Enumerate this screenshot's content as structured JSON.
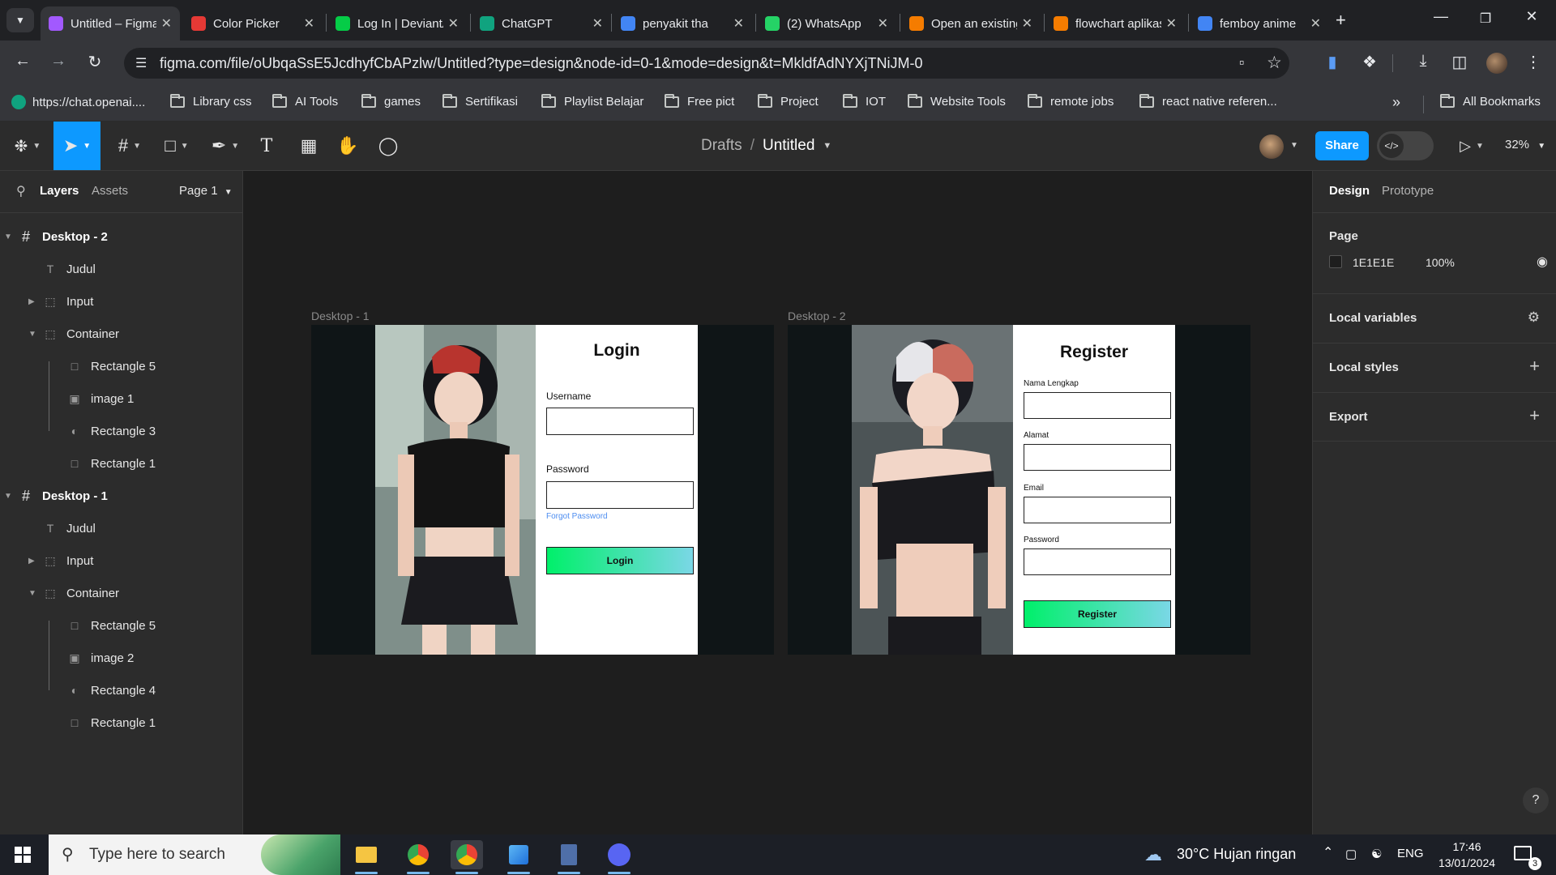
{
  "browser": {
    "tabs": [
      {
        "label": "Untitled – Figma",
        "color": "#a259ff",
        "active": true
      },
      {
        "label": "Color Picker",
        "color": "#e53935"
      },
      {
        "label": "Log In | DeviantArt",
        "color": "#05cc47"
      },
      {
        "label": "ChatGPT",
        "color": "#10a37f"
      },
      {
        "label": "penyakit tha",
        "color": "#4285f4"
      },
      {
        "label": "(2) WhatsApp",
        "color": "#25d366"
      },
      {
        "label": "Open an existing",
        "color": "#f57c00"
      },
      {
        "label": "flowchart aplikasi",
        "color": "#f57c00"
      },
      {
        "label": "femboy anime",
        "color": "#4285f4"
      }
    ],
    "url": "figma.com/file/oUbqaSsE5JcdhyfCbAPzlw/Untitled?type=design&node-id=0-1&mode=design&t=MkldfAdNYXjTNiJM-0",
    "bookmarks": [
      {
        "label": "https://chat.openai....",
        "type": "site"
      },
      {
        "label": "Library css",
        "type": "folder"
      },
      {
        "label": "AI Tools",
        "type": "folder"
      },
      {
        "label": "games",
        "type": "folder"
      },
      {
        "label": "Sertifikasi",
        "type": "folder"
      },
      {
        "label": "Playlist Belajar",
        "type": "folder"
      },
      {
        "label": "Free pict",
        "type": "folder"
      },
      {
        "label": "Project",
        "type": "folder"
      },
      {
        "label": "IOT",
        "type": "folder"
      },
      {
        "label": "Website Tools",
        "type": "folder"
      },
      {
        "label": "remote jobs",
        "type": "folder"
      },
      {
        "label": "react native referen...",
        "type": "folder"
      }
    ],
    "all_bookmarks": "All Bookmarks"
  },
  "figma": {
    "breadcrumb_parent": "Drafts",
    "breadcrumb_sep": "/",
    "file_name": "Untitled",
    "share_label": "Share",
    "zoom": "32%",
    "accent": "#0d99ff",
    "left": {
      "tab_layers": "Layers",
      "tab_assets": "Assets",
      "page_selector": "Page 1",
      "layers": [
        {
          "label": "Desktop - 2",
          "icon": "frame-icon",
          "level": 0,
          "bold": true,
          "arrow": "down"
        },
        {
          "label": "Judul",
          "icon": "text-icon",
          "level": 1
        },
        {
          "label": "Input",
          "icon": "group-icon",
          "level": 1,
          "arrow": "right"
        },
        {
          "label": "Container",
          "icon": "group-icon",
          "level": 1,
          "arrow": "down"
        },
        {
          "label": "Rectangle 5",
          "icon": "rectangle-icon",
          "level": 2,
          "mask": true
        },
        {
          "label": "image 1",
          "icon": "image-icon",
          "level": 2
        },
        {
          "label": "Rectangle 3",
          "icon": "mask-icon",
          "level": 2
        },
        {
          "label": "Rectangle 1",
          "icon": "rectangle-icon",
          "level": 2
        },
        {
          "label": "Desktop - 1",
          "icon": "frame-icon",
          "level": 0,
          "bold": true,
          "arrow": "down"
        },
        {
          "label": "Judul",
          "icon": "text-icon",
          "level": 1
        },
        {
          "label": "Input",
          "icon": "group-icon",
          "level": 1,
          "arrow": "right"
        },
        {
          "label": "Container",
          "icon": "group-icon",
          "level": 1,
          "arrow": "down"
        },
        {
          "label": "Rectangle 5",
          "icon": "rectangle-icon",
          "level": 2,
          "mask": true
        },
        {
          "label": "image 2",
          "icon": "image-icon",
          "level": 2
        },
        {
          "label": "Rectangle 4",
          "icon": "mask-icon",
          "level": 2
        },
        {
          "label": "Rectangle 1",
          "icon": "rectangle-icon",
          "level": 2
        }
      ]
    },
    "canvas": {
      "frame1": {
        "title": "Desktop - 1",
        "form_title": "Login",
        "username_label": "Username",
        "password_label": "Password",
        "forgot_label": "Forgot Password",
        "button_label": "Login"
      },
      "frame2": {
        "title": "Desktop - 2",
        "form_title": "Register",
        "fields": [
          "Nama Lengkap",
          "Alamat",
          "Email",
          "Password"
        ],
        "button_label": "Register"
      }
    },
    "right": {
      "tab_design": "Design",
      "tab_prototype": "Prototype",
      "page_heading": "Page",
      "page_color": "1E1E1E",
      "page_opacity": "100%",
      "local_variables": "Local variables",
      "local_styles": "Local styles",
      "export": "Export",
      "help": "?"
    }
  },
  "taskbar": {
    "search_placeholder": "Type here to search",
    "weather": "30°C  Hujan ringan",
    "language": "ENG",
    "time": "17:46",
    "date": "13/01/2024",
    "notifications": "3"
  }
}
